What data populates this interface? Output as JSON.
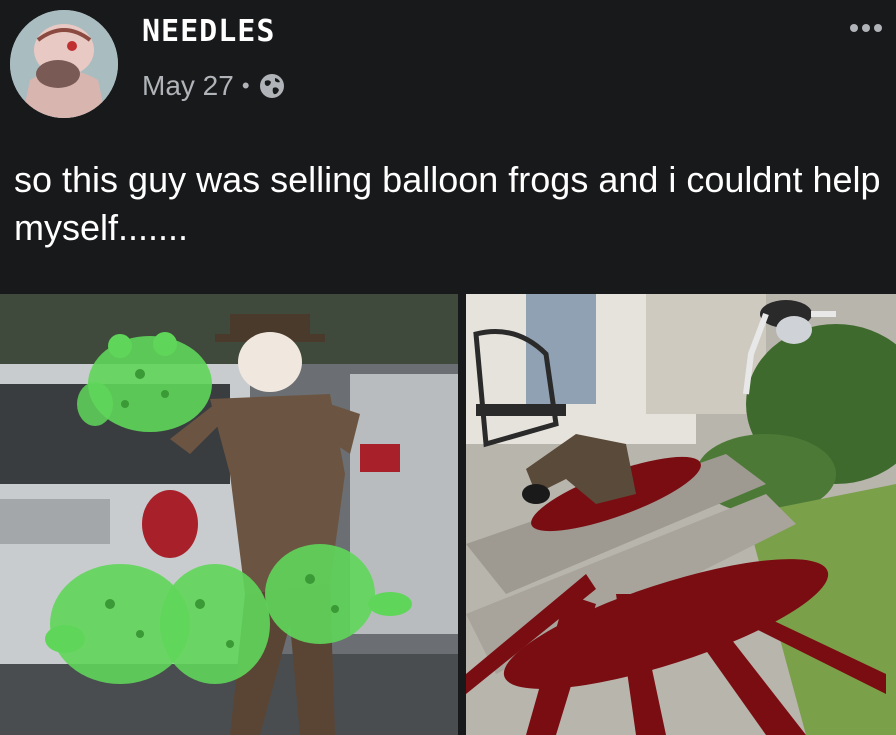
{
  "post": {
    "author": "NEEDLES",
    "date": "May 27",
    "separator": "•",
    "visibility_icon": "globe-icon",
    "text": "so this guy was selling balloon frogs and i couldnt help myself.......",
    "more_icon": "more-horizontal-icon"
  },
  "photos": [
    {
      "name": "photo-balloon-frogs",
      "description_icon": "balloon-frog-seller-image"
    },
    {
      "name": "photo-aftermath",
      "description_icon": "porch-aftermath-image"
    }
  ],
  "colors": {
    "background": "#18191a",
    "text_primary": "#ffffff",
    "text_secondary": "#b0b3b8",
    "frog_green": "#5fd65a",
    "blood": "#7a0d12"
  }
}
